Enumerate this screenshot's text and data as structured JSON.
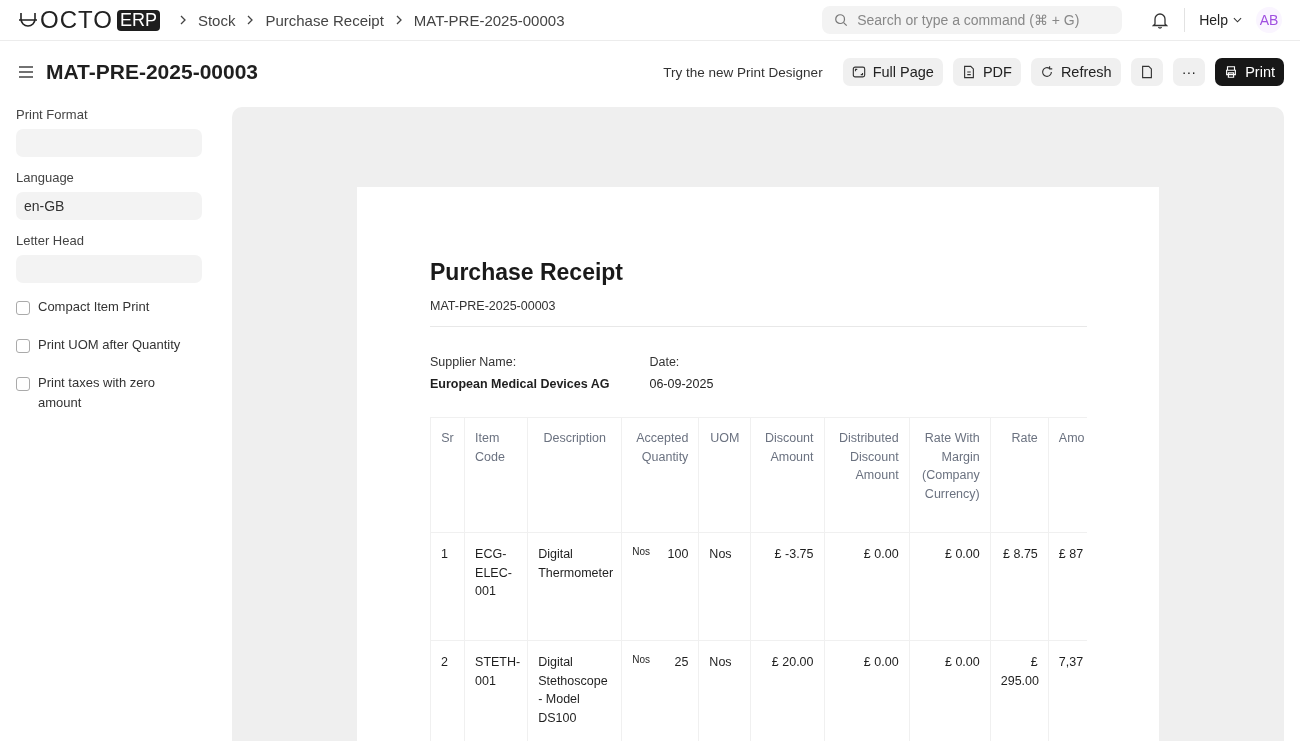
{
  "navbar": {
    "logo": {
      "text": "OCTO",
      "badge": "ERP"
    },
    "breadcrumbs": [
      "Stock",
      "Purchase Receipt",
      "MAT-PRE-2025-00003"
    ],
    "search": {
      "placeholder": "Search or type a command (⌘ + G)"
    },
    "help": "Help",
    "avatar": "AB"
  },
  "page_header": {
    "title": "MAT-PRE-2025-00003",
    "designer_link": "Try the new Print Designer",
    "buttons": [
      {
        "label": "Full Page",
        "kind": "fullpage"
      },
      {
        "label": "PDF",
        "kind": "pdf"
      },
      {
        "label": "Refresh",
        "kind": "refresh"
      },
      {
        "kind": "doc"
      },
      {
        "label": "···",
        "kind": "more"
      },
      {
        "label": "Print",
        "kind": "print"
      }
    ]
  },
  "sidebar": {
    "fields": [
      {
        "label": "Print Format"
      },
      {
        "label": "Language",
        "value": "en-GB"
      },
      {
        "label": "Letter Head"
      }
    ],
    "checkboxes": [
      {
        "label": "Compact Item Print",
        "checked": false
      },
      {
        "label": "Print UOM after Quantity",
        "checked": false
      },
      {
        "label": "Print taxes with zero amount",
        "checked": false
      }
    ]
  },
  "document": {
    "title": "Purchase Receipt",
    "number": "MAT-PRE-2025-00003",
    "supplier_label": "Supplier Name:",
    "supplier": "European Medical Devices AG",
    "date_label": "Date:",
    "date": "06-09-2025",
    "table": {
      "columns": [
        "Sr",
        "Item Code",
        "Description",
        "Accepted Quantity",
        "UOM",
        "Discount Amount",
        "Distributed Discount Amount",
        "Rate With Margin (Company Currency)",
        "Rate",
        "Amo"
      ],
      "rows": [
        {
          "sr": "1",
          "item_code": "ECG-ELEC-001",
          "description": "Digital Thermometer",
          "qty_uom": "Nos",
          "qty": "100",
          "uom": "Nos",
          "discount": "£ -3.75",
          "distributed": "£ 0.00",
          "rate_margin": "£ 0.00",
          "rate": "£ 8.75",
          "amount": "£ 87"
        },
        {
          "sr": "2",
          "item_code": "STETH-001",
          "description": "Digital Stethoscope - Model DS100",
          "qty_uom": "Nos",
          "qty": "25",
          "uom": "Nos",
          "discount": "£ 20.00",
          "distributed": "£ 0.00",
          "rate_margin": "£ 0.00",
          "rate": "£ 295.00",
          "amount": "7,37"
        }
      ]
    }
  }
}
